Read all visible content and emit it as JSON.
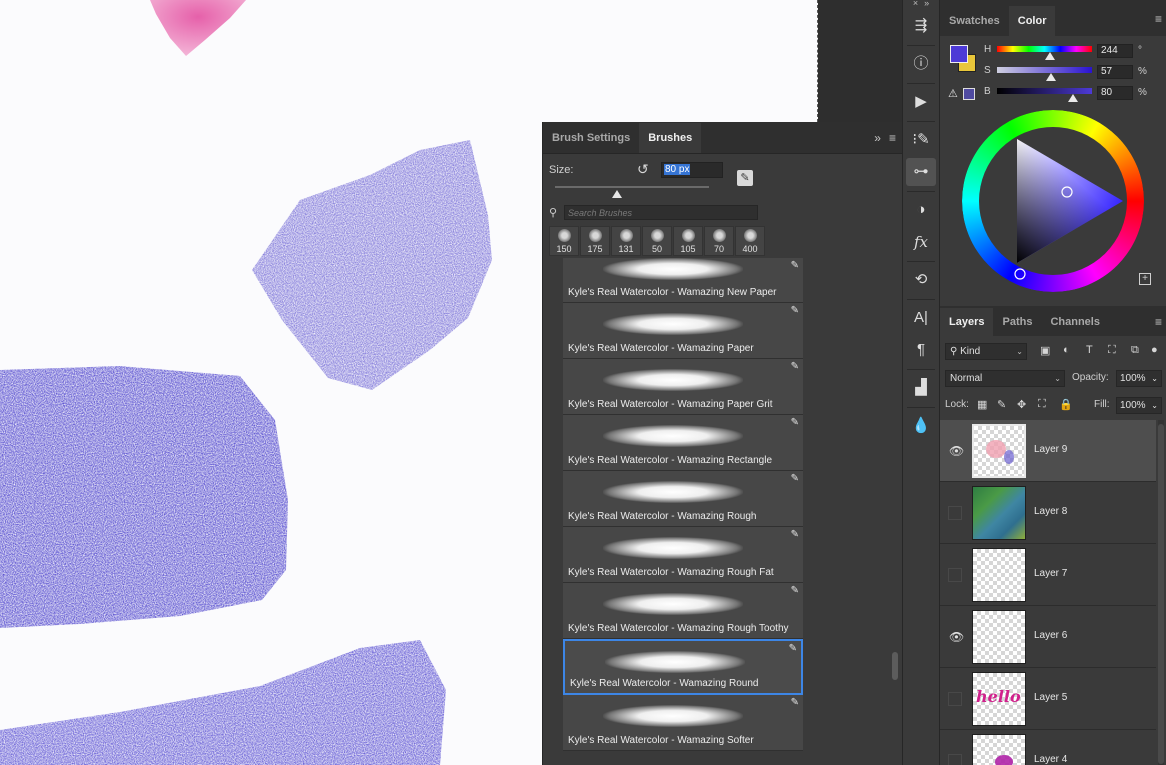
{
  "brushes_panel": {
    "tabs": [
      "Brush Settings",
      "Brushes"
    ],
    "active_tab": "Brushes",
    "size_label": "Size:",
    "size_value": "80 px",
    "size_slider_fraction": 0.4,
    "search_placeholder": "Search Brushes",
    "recent_brush_sizes": [
      "150",
      "175",
      "131",
      "50",
      "105",
      "70",
      "400"
    ],
    "brushes": [
      {
        "name": "Kyle's Real Watercolor - Wamazing New Paper",
        "selected": false
      },
      {
        "name": "Kyle's Real Watercolor - Wamazing Paper",
        "selected": false
      },
      {
        "name": "Kyle's Real Watercolor - Wamazing Paper Grit",
        "selected": false
      },
      {
        "name": "Kyle's Real Watercolor - Wamazing Rectangle",
        "selected": false
      },
      {
        "name": "Kyle's Real Watercolor - Wamazing Rough",
        "selected": false
      },
      {
        "name": "Kyle's Real Watercolor - Wamazing Rough Fat",
        "selected": false
      },
      {
        "name": "Kyle's Real Watercolor - Wamazing Rough Toothy",
        "selected": false
      },
      {
        "name": "Kyle's Real Watercolor - Wamazing Round",
        "selected": true
      },
      {
        "name": "Kyle's Real Watercolor - Wamazing Softer",
        "selected": false
      }
    ]
  },
  "color_panel": {
    "tabs": [
      "Swatches",
      "Color"
    ],
    "active_tab": "Color",
    "foreground_color": "#4d3ad6",
    "background_color": "#e8c63a",
    "h": {
      "label": "H",
      "value": "244",
      "unit": "°"
    },
    "s": {
      "label": "S",
      "value": "57",
      "unit": "%"
    },
    "b": {
      "label": "B",
      "value": "80",
      "unit": "%"
    }
  },
  "layers_panel": {
    "tabs": [
      "Layers",
      "Paths",
      "Channels"
    ],
    "active_tab": "Layers",
    "kind_filter": "Kind",
    "blend_mode": "Normal",
    "opacity_label": "Opacity:",
    "opacity": "100%",
    "lock_label": "Lock:",
    "fill_label": "Fill:",
    "fill": "100%",
    "layers": [
      {
        "name": "Layer 9",
        "visible": true,
        "selected": true
      },
      {
        "name": "Layer 8",
        "visible": false,
        "selected": false
      },
      {
        "name": "Layer 7",
        "visible": false,
        "selected": false
      },
      {
        "name": "Layer 6",
        "visible": true,
        "selected": false
      },
      {
        "name": "Layer 5",
        "visible": false,
        "selected": false
      },
      {
        "name": "Layer 4",
        "visible": false,
        "selected": false
      }
    ]
  },
  "tool_strip": {
    "icons": [
      "libraries-icon",
      "info-icon",
      "actions-play-icon",
      "brush-settings-icon",
      "adjust-sliders-icon",
      "adjustments-icon",
      "fx-styles-icon",
      "history-icon",
      "character-icon",
      "paragraph-icon",
      "glyphs-icon",
      "paint-drop-icon"
    ]
  }
}
